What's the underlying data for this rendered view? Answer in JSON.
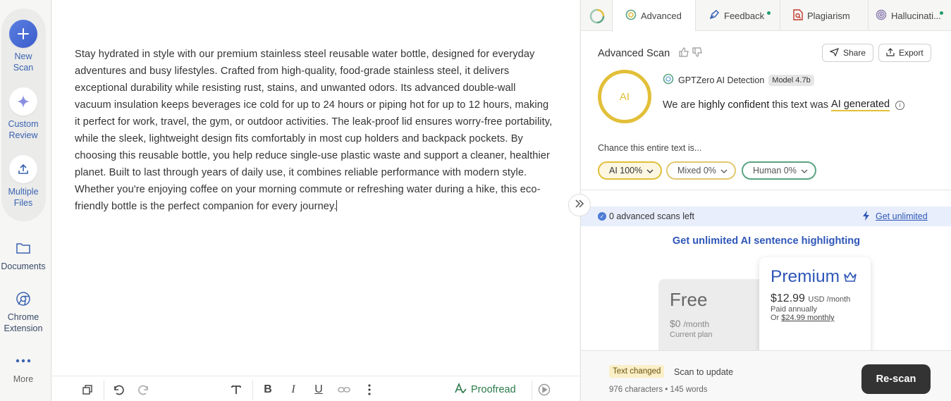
{
  "sidebar": {
    "new_scan": "New\nScan",
    "new_scan_l1": "New",
    "new_scan_l2": "Scan",
    "custom_l1": "Custom",
    "custom_l2": "Review",
    "multiple_l1": "Multiple",
    "multiple_l2": "Files",
    "documents": "Documents",
    "chrome_l1": "Chrome",
    "chrome_l2": "Extension",
    "more": "More"
  },
  "editor": {
    "text": "Stay hydrated in style with our premium stainless steel reusable water bottle, designed for everyday adventures and busy lifestyles. Crafted from high-quality, food-grade stainless steel, it delivers exceptional durability while resisting rust, stains, and unwanted odors. Its advanced double-wall vacuum insulation keeps beverages ice cold for up to 24 hours or piping hot for up to 12 hours, making it perfect for work, travel, the gym, or outdoor activities. The leak-proof lid ensures worry-free portability, while the sleek, lightweight design fits comfortably in most cup holders and backpack pockets. By choosing this reusable bottle, you help reduce single-use plastic waste and support a cleaner, healthier planet. Built to last through years of daily use, it combines reliable performance with modern style. Whether you're enjoying coffee on your morning commute or refreshing water during a hike, this eco-friendly bottle is the perfect companion for every journey.",
    "proofread_label": "Proofread"
  },
  "tabs": [
    {
      "label": "Advanced"
    },
    {
      "label": "Feedback"
    },
    {
      "label": "Plagiarism"
    },
    {
      "label": "Hallucinati..."
    }
  ],
  "scan": {
    "title": "Advanced Scan",
    "share": "Share",
    "export": "Export",
    "ring_label": "AI",
    "detector": "GPTZero AI Detection",
    "model": "Model 4.7b",
    "conf_pre": "We are",
    "conf_strong": "highly confident",
    "conf_mid": "this text was",
    "conf_result": "AI generated",
    "chance_label": "Chance this entire text is...",
    "ai_pill": "AI 100%",
    "mixed_pill": "Mixed 0%",
    "human_pill": "Human 0%"
  },
  "colors": {
    "ai_yellow": "#e2bf38",
    "human_green": "#5aa383",
    "link_blue": "#2e56b8"
  },
  "quota": {
    "scans_left": "0 advanced scans left",
    "get_unlimited": "Get unlimited"
  },
  "upsell": {
    "headline": "Get unlimited AI sentence highlighting",
    "free_name": "Free",
    "free_price": "$0",
    "free_period": "/month",
    "free_sub": "Current plan",
    "premium_name": "Premium",
    "premium_price": "$12.99",
    "premium_period": "USD /month",
    "premium_billing": "Paid annually",
    "premium_or": "Or",
    "premium_monthly": "$24.99 monthly"
  },
  "footer": {
    "badge": "Text changed",
    "hint": "Scan to update",
    "counts": "976 characters • 145 words",
    "rescan": "Re-scan"
  }
}
